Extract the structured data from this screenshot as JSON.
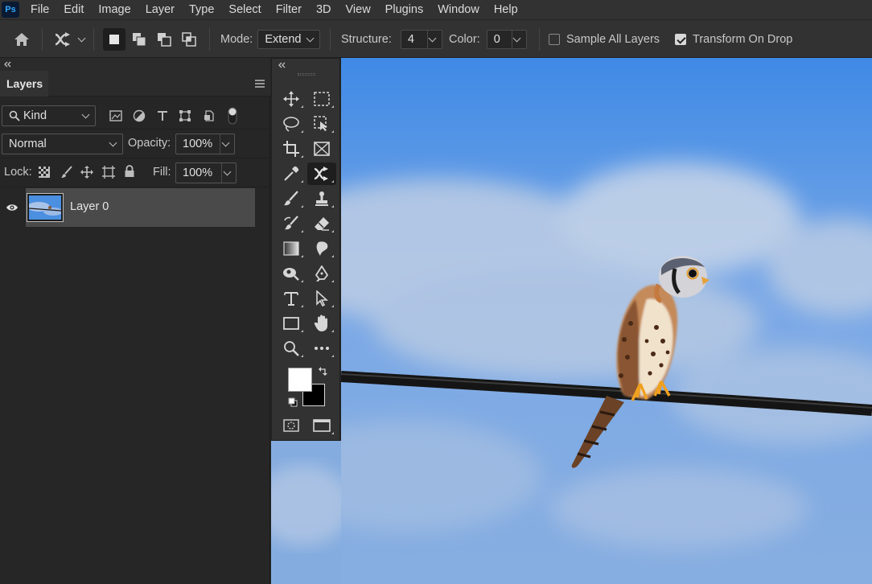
{
  "app": {
    "logo": "Ps"
  },
  "menu": [
    "File",
    "Edit",
    "Image",
    "Layer",
    "Type",
    "Select",
    "Filter",
    "3D",
    "View",
    "Plugins",
    "Window",
    "Help"
  ],
  "options": {
    "mode_label": "Mode:",
    "mode_value": "Extend",
    "structure_label": "Structure:",
    "structure_value": "4",
    "color_label": "Color:",
    "color_value": "0",
    "sample_all_layers_label": "Sample All Layers",
    "sample_all_layers_checked": false,
    "transform_on_drop_label": "Transform On Drop",
    "transform_on_drop_checked": true
  },
  "layers_panel": {
    "tab_title": "Layers",
    "filter_kind": "Kind",
    "blend_mode": "Normal",
    "opacity_label": "Opacity:",
    "opacity_value": "100%",
    "lock_label": "Lock:",
    "fill_label": "Fill:",
    "fill_value": "100%",
    "layers": [
      {
        "name": "Layer 0",
        "visible": true,
        "selected": true
      }
    ]
  },
  "tools": {
    "active": "content-aware-move",
    "foreground_color": "#ffffff",
    "background_color": "#000000"
  },
  "colors": {
    "panel_bg": "#262626",
    "bar_bg": "#323232",
    "selection": "#4a4a4a",
    "sky_top": "#3f8ae6",
    "sky_bottom": "#87aee0"
  }
}
